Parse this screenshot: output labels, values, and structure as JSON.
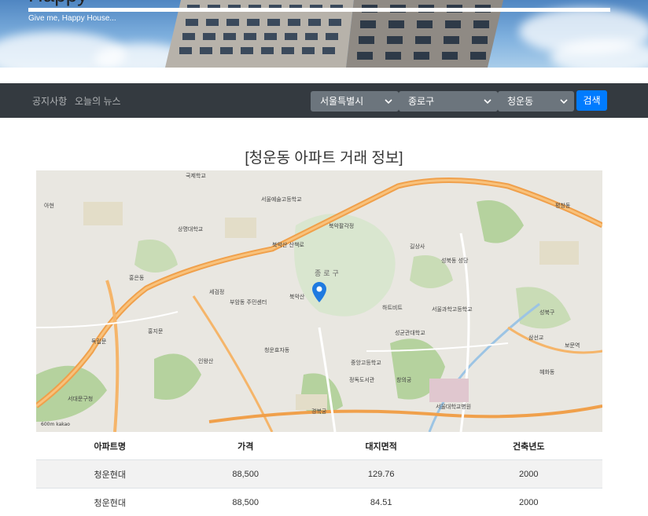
{
  "hero": {
    "title": "Happy",
    "subtitle": "Give me, Happy House..."
  },
  "nav": {
    "links": [
      "공지사항",
      "오늘의 뉴스"
    ],
    "selects": {
      "city": "서울특별시",
      "district": "종로구",
      "dong": "청운동"
    },
    "search_label": "검색"
  },
  "page_title": "[청운동 아파트 거래 정보]",
  "map": {
    "district_label": "종로구",
    "marker_icon": "map-pin-icon",
    "scale_label": "600m",
    "provider": "kakao",
    "place_labels": [
      "국제학교",
      "서울예술고등학교",
      "북악팔각정",
      "길상사",
      "성북동 성당",
      "북악산",
      "부암동 주민센터",
      "청운효자동",
      "상명대학교",
      "홍은동",
      "서대문구청",
      "독립문",
      "경복궁",
      "창의궁",
      "서울과학고등학교",
      "성균관대학교",
      "혜화동",
      "성북구",
      "삼선교",
      "아현",
      "서울대학교병원",
      "중앙고등학교",
      "정독도서관",
      "세검정",
      "북악산 산책로",
      "보문역",
      "평창동",
      "홍지문",
      "하트비트",
      "인왕산"
    ]
  },
  "table": {
    "headers": [
      "아파트명",
      "가격",
      "대지면적",
      "건축년도"
    ],
    "rows": [
      [
        "청운현대",
        "88,500",
        "129.76",
        "2000"
      ],
      [
        "청운현대",
        "88,500",
        "84.51",
        "2000"
      ]
    ]
  },
  "colors": {
    "navbar": "#343a40",
    "select": "#6c757d",
    "primary": "#007bff",
    "road": "#f0a04b",
    "park": "#b5d29e",
    "marker": "#1f7ae0"
  }
}
